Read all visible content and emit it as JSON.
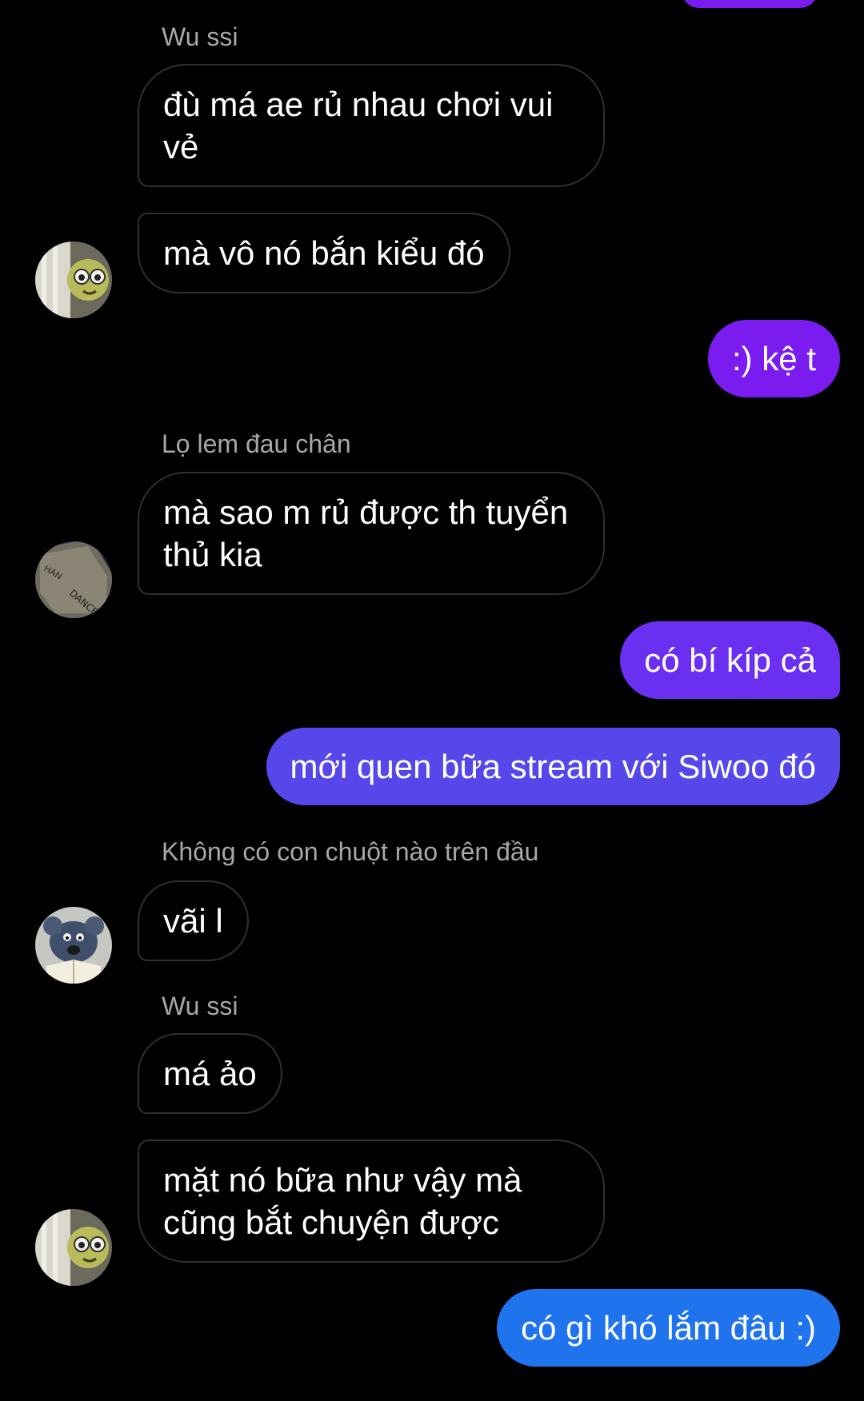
{
  "colors": {
    "background": "#000000",
    "incoming_border": "#2f2f2f",
    "sender_name": "#a8a8a8",
    "outgoing_purple": "#7a1cf0",
    "outgoing_violet": "#6b2ff2",
    "outgoing_indigo": "#5547ea",
    "outgoing_blue": "#1f73ec"
  },
  "messages": [
    {
      "sender": "Wu ssi",
      "text": "đù má ae rủ nhau chơi vui vẻ"
    },
    {
      "text": "mà vô nó bắn kiểu đó"
    },
    {
      "outgoing": true,
      "text": ":) kệ t"
    },
    {
      "sender": "Lọ lem đau chân",
      "text": "mà sao m rủ được th tuyển thủ kia"
    },
    {
      "outgoing": true,
      "text": "có bí kíp cả"
    },
    {
      "outgoing": true,
      "text": "mới quen bữa stream với Siwoo đó"
    },
    {
      "sender": "Không có con chuột nào trên đầu",
      "text": "vãi l"
    },
    {
      "sender": "Wu ssi",
      "text": "má ảo"
    },
    {
      "text": "mặt nó bữa như vậy mà cũng bắt chuyện được"
    },
    {
      "outgoing": true,
      "text": "có gì khó lắm đâu :)"
    }
  ],
  "avatars": {
    "wu_ssi": "cartoon-creature-avatar",
    "lo_lem": "dance-card-avatar",
    "khong_co_con_chuot": "rat-reading-book-avatar"
  }
}
